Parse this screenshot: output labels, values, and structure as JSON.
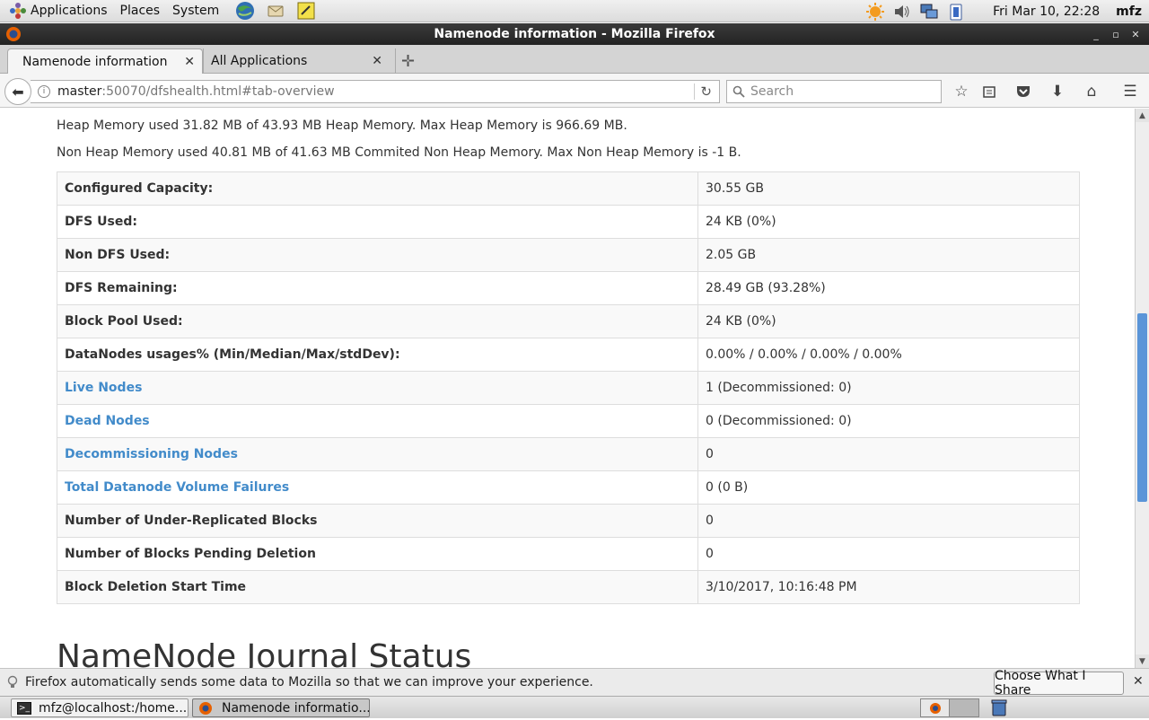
{
  "top_panel": {
    "menus": [
      "Applications",
      "Places",
      "System"
    ],
    "clock": "Fri Mar 10, 22:28",
    "user": "mfz"
  },
  "window": {
    "title": "Namenode information - Mozilla Firefox"
  },
  "tabs": [
    {
      "label": "Namenode information",
      "active": true
    },
    {
      "label": "All Applications",
      "active": false
    }
  ],
  "nav": {
    "url_host": "master",
    "url_rest": ":50070/dfshealth.html#tab-overview",
    "search_placeholder": "Search"
  },
  "content": {
    "heap_memory": "Heap Memory used 31.82 MB of 43.93 MB Heap Memory. Max Heap Memory is 966.69 MB.",
    "non_heap_memory": "Non Heap Memory used 40.81 MB of 41.63 MB Commited Non Heap Memory. Max Non Heap Memory is -1 B.",
    "rows": [
      {
        "label": "Configured Capacity:",
        "value": "30.55 GB",
        "link": false
      },
      {
        "label": "DFS Used:",
        "value": "24 KB (0%)",
        "link": false
      },
      {
        "label": "Non DFS Used:",
        "value": "2.05 GB",
        "link": false
      },
      {
        "label": "DFS Remaining:",
        "value": "28.49 GB (93.28%)",
        "link": false
      },
      {
        "label": "Block Pool Used:",
        "value": "24 KB (0%)",
        "link": false
      },
      {
        "label": "DataNodes usages% (Min/Median/Max/stdDev):",
        "value": "0.00% / 0.00% / 0.00% / 0.00%",
        "link": false
      },
      {
        "label": "Live Nodes",
        "value": "1 (Decommissioned: 0)",
        "link": true
      },
      {
        "label": "Dead Nodes",
        "value": "0 (Decommissioned: 0)",
        "link": true
      },
      {
        "label": "Decommissioning Nodes",
        "value": "0",
        "link": true
      },
      {
        "label": "Total Datanode Volume Failures",
        "value": "0 (0 B)",
        "link": true
      },
      {
        "label": "Number of Under-Replicated Blocks",
        "value": "0",
        "link": false
      },
      {
        "label": "Number of Blocks Pending Deletion",
        "value": "0",
        "link": false
      },
      {
        "label": "Block Deletion Start Time",
        "value": "3/10/2017, 10:16:48 PM",
        "link": false
      }
    ],
    "journal_heading": "NameNode Journal Status"
  },
  "notification": {
    "message": "Firefox automatically sends some data to Mozilla so that we can improve your experience.",
    "button": "Choose What I Share"
  },
  "taskbar": {
    "tasks": [
      {
        "label": "mfz@localhost:/home...",
        "active": false
      },
      {
        "label": "Namenode informatio...",
        "active": true
      }
    ]
  },
  "colors": {
    "link": "#428bca",
    "scroll_thumb": "#5a95d8",
    "titlebar": "#2b2b2b"
  }
}
